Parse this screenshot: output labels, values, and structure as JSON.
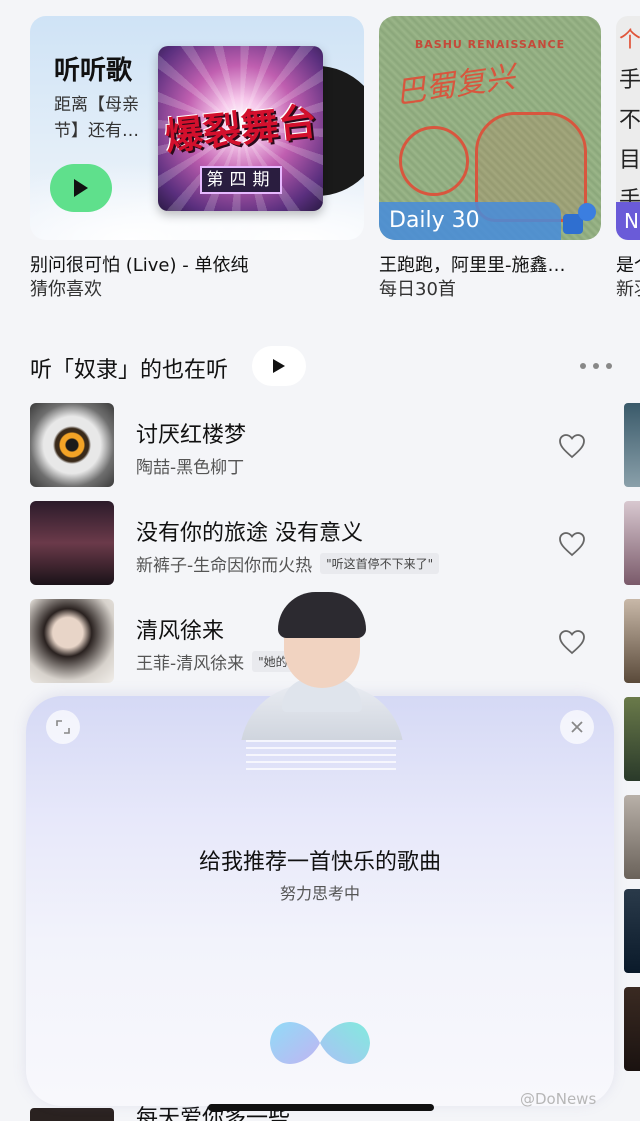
{
  "cards": [
    {
      "title": "听听歌",
      "subtitle": "距离【母亲节】还有…",
      "album_title": "爆裂舞台",
      "album_episode": "第四期",
      "caption": "别问很可怕 (Live) - 单依纯",
      "caption2": "猜你喜欢"
    },
    {
      "cover_top": "BASHU RENAISSANCE",
      "cover_script": "巴蜀复兴",
      "badge": "Daily 30",
      "caption": "王跑跑，阿里里-施鑫…",
      "caption2": "每日30首"
    },
    {
      "cover_glyphs": [
        "个",
        "手",
        "不",
        "目",
        "手"
      ],
      "badge": "N",
      "caption": "是个",
      "caption2": "新羽"
    }
  ],
  "section": {
    "title": "听「奴隶」的也在听"
  },
  "songs": [
    {
      "title": "讨厌红楼梦",
      "artist": "陶喆-黑色柳丁",
      "tag": ""
    },
    {
      "title": "没有你的旅途 没有意义",
      "artist": "新裤子-生命因你而火热",
      "tag": "\"听这首停不下来了\""
    },
    {
      "title": "清风徐来",
      "artist": "王菲-清风徐来",
      "tag": "\"她的声音很美\""
    }
  ],
  "assistant": {
    "query": "给我推荐一首快乐的歌曲",
    "status": "努力思考中"
  },
  "bottom_song": {
    "title": "每天爱你多一些"
  },
  "watermark": "@DoNews",
  "colors": {
    "play_green": "#5fe08c",
    "daily_blue": "#468cdc",
    "panel_top": "#d5d9f5"
  }
}
